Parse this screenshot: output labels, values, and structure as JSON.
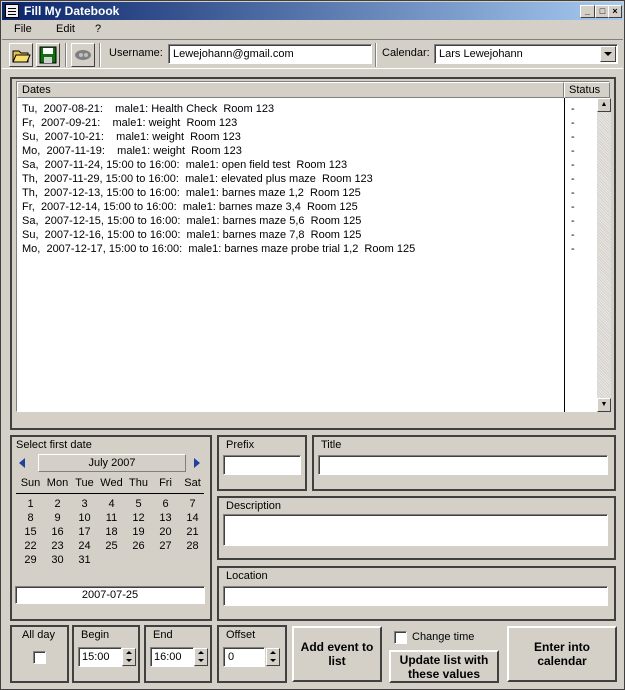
{
  "window": {
    "title": "Fill My Datebook"
  },
  "menu": {
    "file": "File",
    "edit": "Edit",
    "help": "?"
  },
  "toolbar": {
    "username_label": "Username:",
    "username_value": "Lewejohann@gmail.com",
    "calendar_label": "Calendar:",
    "calendar_value": "Lars Lewejohann",
    "icons": [
      "open-folder-icon",
      "save-disk-icon",
      "google-connect-icon"
    ]
  },
  "list": {
    "col_dates": "Dates",
    "col_status": "Status",
    "rows": [
      {
        "text": "Tu,  2007-08-21:    male1: Health Check  Room 123",
        "status": "-"
      },
      {
        "text": "Fr,  2007-09-21:    male1: weight  Room 123",
        "status": "-"
      },
      {
        "text": "Su,  2007-10-21:    male1: weight  Room 123",
        "status": "-"
      },
      {
        "text": "Mo,  2007-11-19:    male1: weight  Room 123",
        "status": "-"
      },
      {
        "text": "Sa,  2007-11-24, 15:00 to 16:00:  male1: open field test  Room 123",
        "status": "-"
      },
      {
        "text": "Th,  2007-11-29, 15:00 to 16:00:  male1: elevated plus maze  Room 123",
        "status": "-"
      },
      {
        "text": "Th,  2007-12-13, 15:00 to 16:00:  male1: barnes maze 1,2  Room 125",
        "status": "-"
      },
      {
        "text": "Fr,  2007-12-14, 15:00 to 16:00:  male1: barnes maze 3,4  Room 125",
        "status": "-"
      },
      {
        "text": "Sa,  2007-12-15, 15:00 to 16:00:  male1: barnes maze 5,6  Room 125",
        "status": "-"
      },
      {
        "text": "Su,  2007-12-16, 15:00 to 16:00:  male1: barnes maze 7,8  Room 125",
        "status": "-"
      },
      {
        "text": "Mo,  2007-12-17, 15:00 to 16:00:  male1: barnes maze probe trial 1,2  Room 125",
        "status": "-"
      }
    ]
  },
  "calendar": {
    "title": "Select first date",
    "month": "July 2007",
    "weekdays": [
      "Sun",
      "Mon",
      "Tue",
      "Wed",
      "Thu",
      "Fri",
      "Sat"
    ],
    "weeks": [
      [
        "1",
        "2",
        "3",
        "4",
        "5",
        "6",
        "7"
      ],
      [
        "8",
        "9",
        "10",
        "11",
        "12",
        "13",
        "14"
      ],
      [
        "15",
        "16",
        "17",
        "18",
        "19",
        "20",
        "21"
      ],
      [
        "22",
        "23",
        "24",
        "25",
        "26",
        "27",
        "28"
      ],
      [
        "29",
        "30",
        "31",
        "",
        "",
        "",
        ""
      ]
    ],
    "selected": "2007-07-25"
  },
  "form": {
    "prefix_label": "Prefix",
    "prefix_value": "",
    "title_label": "Title",
    "title_value": "",
    "description_label": "Description",
    "description_value": "",
    "location_label": "Location",
    "location_value": ""
  },
  "bottom": {
    "allday_label": "All day",
    "begin_label": "Begin",
    "begin_value": "15:00",
    "end_label": "End",
    "end_value": "16:00",
    "offset_label": "Offset",
    "offset_value": "0",
    "add_event": "Add event to list",
    "change_time": "Change time",
    "update_list": "Update list with these values",
    "enter_calendar": "Enter into calendar"
  }
}
